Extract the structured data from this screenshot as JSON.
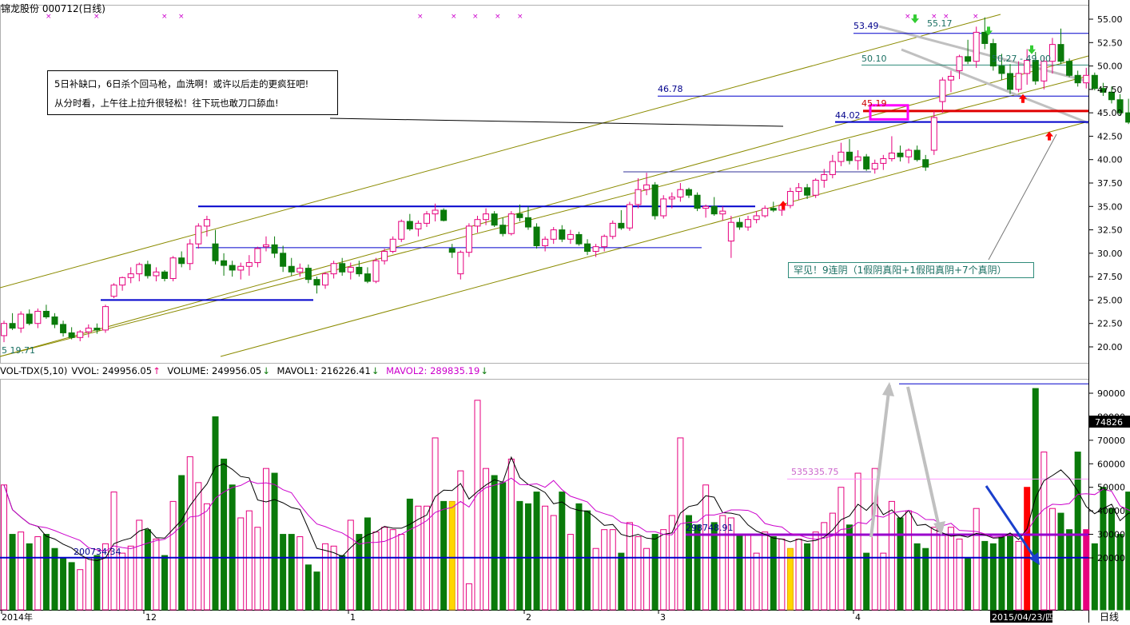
{
  "header": {
    "title": "锦龙股份 000712(日线)"
  },
  "colors": {
    "up": "#e6007e",
    "down": "#0a7a0a",
    "price_line": "#0000cc",
    "channel": "#8b8b00",
    "highlight": "#ffd700",
    "mavol1": "#000000",
    "mavol2": "#cc00cc"
  },
  "annotations": {
    "note_line1": "5日补缺口，6日杀个回马枪，血洗啊！或许以后走的更疯狂吧!",
    "note_line2": "从分时看，上午往上拉升很轻松！往下玩也敢刀口舔血!",
    "rare_note": "罕见！9连阴（1假阴真阳+1假阳真阴+7个真阴）"
  },
  "volume_header": {
    "indicator": "VOL-TDX(5,10)",
    "vvol": "VVOL: 249956.05",
    "volume": "VOLUME: 249956.05",
    "mavol1": "MAVOL1: 216226.41",
    "mavol2": "MAVOL2: 289835.19"
  },
  "price_labels": {
    "low_label": "5  19.71",
    "high_label": "55.17",
    "l5349": "53.49",
    "l5010": "50.10",
    "l4678": "46.78",
    "l4519": "45.19",
    "l4402": "44.02",
    "range_label": "50.27 - 49.00"
  },
  "volume_labels": {
    "v535": "535335.75",
    "v298": "298748.91",
    "v200": "200734.34",
    "current_box": "74826"
  },
  "footer": {
    "date_box": "2015/04/23/四",
    "period": "日线"
  },
  "chart_data": [
    {
      "type": "candlestick",
      "name": "price",
      "yticks": [
        20.0,
        22.5,
        25.0,
        27.5,
        30.0,
        32.5,
        35.0,
        37.5,
        40.0,
        42.5,
        45.0,
        47.5,
        50.0,
        52.5,
        55.0
      ],
      "ylim": [
        18.2,
        56.0
      ],
      "xticks": [
        "2014年",
        "12",
        "1",
        "2",
        "3",
        "4"
      ],
      "candles": [
        [
          21.2,
          22.8,
          20.5,
          22.5
        ],
        [
          22.5,
          23.6,
          21.8,
          22.0
        ],
        [
          22.0,
          23.8,
          21.5,
          23.5
        ],
        [
          23.5,
          24.0,
          22.3,
          22.5
        ],
        [
          22.5,
          24.1,
          22.0,
          23.8
        ],
        [
          23.8,
          24.5,
          23.0,
          23.2
        ],
        [
          23.2,
          23.6,
          22.0,
          22.4
        ],
        [
          22.4,
          22.8,
          21.1,
          21.5
        ],
        [
          21.5,
          22.1,
          20.8,
          21.0
        ],
        [
          21.0,
          21.8,
          20.6,
          21.6
        ],
        [
          21.6,
          22.4,
          21.0,
          22.0
        ],
        [
          22.0,
          22.5,
          21.4,
          21.8
        ],
        [
          21.8,
          24.5,
          21.5,
          24.3
        ],
        [
          25.4,
          26.8,
          25.2,
          26.6
        ],
        [
          26.6,
          27.5,
          26.0,
          27.4
        ],
        [
          27.4,
          28.5,
          26.8,
          27.8
        ],
        [
          27.8,
          29.0,
          27.0,
          28.8
        ],
        [
          28.8,
          29.2,
          27.3,
          27.6
        ],
        [
          27.6,
          28.5,
          27.0,
          28.0
        ],
        [
          28.0,
          28.2,
          27.0,
          27.3
        ],
        [
          27.3,
          29.7,
          27.0,
          29.5
        ],
        [
          29.5,
          30.2,
          28.5,
          28.9
        ],
        [
          28.9,
          31.5,
          28.2,
          31.0
        ],
        [
          31.0,
          33.2,
          30.5,
          32.9
        ],
        [
          32.9,
          34.0,
          31.8,
          33.6
        ],
        [
          31.0,
          32.5,
          28.8,
          29.2
        ],
        [
          29.2,
          30.0,
          27.6,
          28.7
        ],
        [
          28.7,
          29.2,
          27.5,
          28.2
        ],
        [
          28.2,
          29.0,
          27.2,
          28.6
        ],
        [
          28.6,
          29.8,
          27.6,
          29.0
        ],
        [
          29.0,
          30.7,
          28.5,
          30.5
        ],
        [
          30.7,
          31.8,
          30.2,
          30.9
        ],
        [
          30.9,
          31.8,
          29.5,
          30.0
        ],
        [
          30.0,
          30.8,
          28.0,
          28.6
        ],
        [
          28.6,
          29.5,
          27.6,
          28.0
        ],
        [
          28.0,
          28.9,
          27.5,
          28.4
        ],
        [
          28.4,
          28.8,
          26.8,
          27.2
        ],
        [
          27.2,
          27.5,
          25.7,
          26.6
        ],
        [
          26.6,
          28.0,
          26.2,
          27.8
        ],
        [
          27.8,
          29.2,
          27.3,
          28.9
        ],
        [
          28.9,
          29.5,
          27.6,
          28.0
        ],
        [
          28.0,
          29.0,
          27.2,
          28.5
        ],
        [
          28.5,
          29.2,
          27.5,
          27.8
        ],
        [
          27.8,
          28.5,
          26.8,
          27.0
        ],
        [
          27.0,
          29.5,
          26.8,
          29.2
        ],
        [
          29.2,
          30.5,
          28.8,
          30.2
        ],
        [
          30.2,
          31.8,
          30.0,
          31.5
        ],
        [
          31.5,
          33.6,
          31.2,
          33.4
        ],
        [
          33.4,
          34.2,
          32.4,
          32.6
        ],
        [
          32.6,
          33.5,
          31.8,
          33.2
        ],
        [
          33.2,
          34.5,
          32.8,
          34.2
        ],
        [
          34.2,
          35.3,
          33.4,
          34.6
        ],
        [
          34.6,
          34.8,
          33.4,
          33.5
        ],
        [
          30.5,
          31.0,
          29.5,
          30.1
        ],
        [
          27.8,
          30.3,
          27.2,
          30.1
        ],
        [
          30.1,
          33.2,
          29.6,
          32.9
        ],
        [
          32.9,
          34.0,
          32.2,
          33.6
        ],
        [
          33.6,
          34.8,
          33.0,
          34.2
        ],
        [
          34.2,
          34.5,
          32.8,
          33.0
        ],
        [
          33.0,
          33.8,
          31.8,
          32.1
        ],
        [
          32.1,
          34.5,
          31.9,
          34.2
        ],
        [
          34.2,
          35.2,
          33.4,
          33.8
        ],
        [
          33.8,
          35.0,
          32.5,
          32.8
        ],
        [
          32.8,
          33.2,
          30.5,
          30.8
        ],
        [
          30.8,
          31.8,
          30.2,
          31.5
        ],
        [
          31.5,
          32.8,
          31.0,
          32.5
        ],
        [
          32.5,
          33.0,
          31.2,
          31.5
        ],
        [
          31.5,
          32.5,
          31.0,
          32.0
        ],
        [
          32.0,
          32.3,
          30.8,
          31.0
        ],
        [
          31.0,
          31.5,
          29.8,
          30.2
        ],
        [
          30.2,
          31.0,
          29.6,
          30.7
        ],
        [
          30.7,
          32.0,
          30.2,
          31.8
        ],
        [
          31.8,
          33.5,
          31.5,
          33.2
        ],
        [
          33.2,
          34.6,
          32.5,
          32.7
        ],
        [
          32.7,
          35.5,
          32.4,
          35.2
        ],
        [
          35.2,
          38.0,
          34.8,
          36.8
        ],
        [
          36.8,
          38.6,
          36.2,
          37.3
        ],
        [
          37.3,
          37.6,
          33.6,
          34.0
        ],
        [
          34.0,
          36.2,
          33.7,
          35.8
        ],
        [
          35.8,
          36.5,
          34.8,
          36.0
        ],
        [
          36.0,
          37.5,
          35.5,
          36.8
        ],
        [
          36.8,
          37.0,
          35.9,
          36.2
        ],
        [
          36.2,
          36.5,
          34.5,
          34.8
        ],
        [
          34.8,
          35.2,
          33.8,
          35.0
        ],
        [
          35.0,
          36.0,
          34.0,
          34.2
        ],
        [
          34.2,
          35.0,
          33.5,
          34.5
        ],
        [
          31.3,
          34.0,
          29.5,
          33.3
        ],
        [
          33.3,
          33.8,
          32.5,
          32.8
        ],
        [
          32.8,
          34.0,
          32.4,
          33.6
        ],
        [
          33.6,
          34.5,
          33.2,
          34.0
        ],
        [
          34.0,
          35.1,
          33.8,
          34.8
        ],
        [
          34.8,
          35.5,
          34.4,
          34.6
        ],
        [
          34.6,
          35.3,
          34.0,
          35.1
        ],
        [
          35.1,
          37.0,
          34.8,
          36.6
        ],
        [
          36.6,
          37.5,
          35.7,
          37.0
        ],
        [
          37.0,
          37.4,
          35.8,
          36.2
        ],
        [
          36.2,
          38.0,
          35.9,
          37.8
        ],
        [
          37.8,
          39.0,
          37.0,
          38.4
        ],
        [
          38.4,
          40.5,
          38.0,
          39.8
        ],
        [
          39.8,
          41.8,
          39.3,
          40.8
        ],
        [
          40.8,
          42.2,
          39.5,
          39.9
        ],
        [
          39.9,
          41.0,
          38.9,
          40.3
        ],
        [
          40.3,
          40.6,
          38.8,
          39.0
        ],
        [
          39.0,
          40.0,
          38.5,
          39.6
        ],
        [
          39.6,
          40.5,
          38.9,
          40.1
        ],
        [
          40.1,
          42.5,
          39.8,
          40.7
        ],
        [
          40.7,
          41.5,
          39.8,
          40.3
        ],
        [
          40.3,
          41.2,
          39.6,
          41.0
        ],
        [
          41.0,
          41.5,
          39.8,
          40.0
        ],
        [
          40.0,
          40.5,
          38.8,
          39.2
        ],
        [
          41.0,
          45.2,
          40.5,
          44.5
        ],
        [
          46.2,
          48.8,
          45.0,
          48.5
        ],
        [
          48.5,
          49.5,
          47.2,
          48.9
        ],
        [
          49.5,
          51.2,
          48.6,
          51.0
        ],
        [
          51.0,
          52.8,
          50.2,
          50.5
        ],
        [
          50.5,
          54.2,
          49.8,
          53.6
        ],
        [
          53.6,
          55.2,
          51.8,
          52.4
        ],
        [
          52.4,
          52.9,
          49.5,
          50.0
        ],
        [
          50.0,
          51.3,
          48.5,
          49.2
        ],
        [
          49.2,
          50.2,
          47.0,
          47.5
        ],
        [
          47.5,
          50.5,
          47.2,
          49.2
        ],
        [
          49.2,
          51.8,
          48.0,
          50.6
        ],
        [
          50.6,
          51.5,
          48.0,
          48.4
        ],
        [
          48.4,
          51.0,
          47.5,
          50.5
        ],
        [
          50.5,
          53.0,
          49.2,
          52.3
        ],
        [
          52.3,
          54.0,
          50.2,
          50.5
        ],
        [
          50.5,
          50.8,
          48.8,
          49.0
        ],
        [
          49.0,
          49.5,
          47.8,
          48.2
        ],
        [
          48.2,
          49.8,
          47.6,
          49.0
        ],
        [
          49.0,
          49.3,
          47.4,
          47.6
        ],
        [
          47.6,
          48.2,
          46.8,
          47.2
        ],
        [
          47.2,
          47.8,
          46.0,
          46.4
        ],
        [
          46.4,
          47.0,
          44.7,
          45.0
        ],
        [
          45.0,
          46.5,
          43.8,
          44.0
        ]
      ]
    },
    {
      "type": "bar",
      "name": "volume",
      "yticks": [
        20000,
        30000,
        40000,
        50000,
        60000,
        70000,
        80000,
        90000
      ],
      "ylim": [
        0,
        100000
      ],
      "values": [
        51000,
        30000,
        31000,
        26000,
        29000,
        30000,
        24000,
        20000,
        18000,
        15000,
        20000,
        21000,
        26000,
        48000,
        22000,
        25000,
        36000,
        32000,
        28000,
        21000,
        44000,
        55000,
        63000,
        52000,
        43000,
        80000,
        62000,
        51000,
        37000,
        40000,
        33000,
        58000,
        56000,
        30000,
        30000,
        29000,
        17000,
        14000,
        26000,
        25000,
        21000,
        36000,
        30000,
        37000,
        31000,
        33000,
        32000,
        30000,
        45000,
        42000,
        42000,
        71000,
        44000,
        44000,
        57000,
        9000,
        87000,
        58000,
        55000,
        52000,
        62000,
        44000,
        43000,
        48000,
        42000,
        38000,
        48000,
        30000,
        43000,
        40000,
        24000,
        32000,
        32000,
        22000,
        35000,
        29000,
        24000,
        30000,
        32000,
        38000,
        71000,
        38000,
        34000,
        51000,
        35000,
        38000,
        37000,
        30000,
        30000,
        22000,
        31000,
        29000,
        28000,
        24000,
        28000,
        26000,
        31000,
        35000,
        39000,
        50000,
        34000,
        56000,
        22000,
        58000,
        22000,
        44000,
        37000,
        40000,
        26000,
        24000,
        33000,
        30000,
        33000,
        28000,
        20000,
        41000,
        27000,
        26000,
        29000,
        30000,
        27000,
        50000,
        92000,
        65000,
        41000,
        39000,
        32000,
        65000,
        32000,
        26000,
        50000,
        41000,
        30000,
        48000,
        26000,
        34000,
        32000,
        30000,
        29000,
        27000,
        26000,
        50000,
        34000,
        21000,
        26000,
        25000
      ]
    }
  ]
}
